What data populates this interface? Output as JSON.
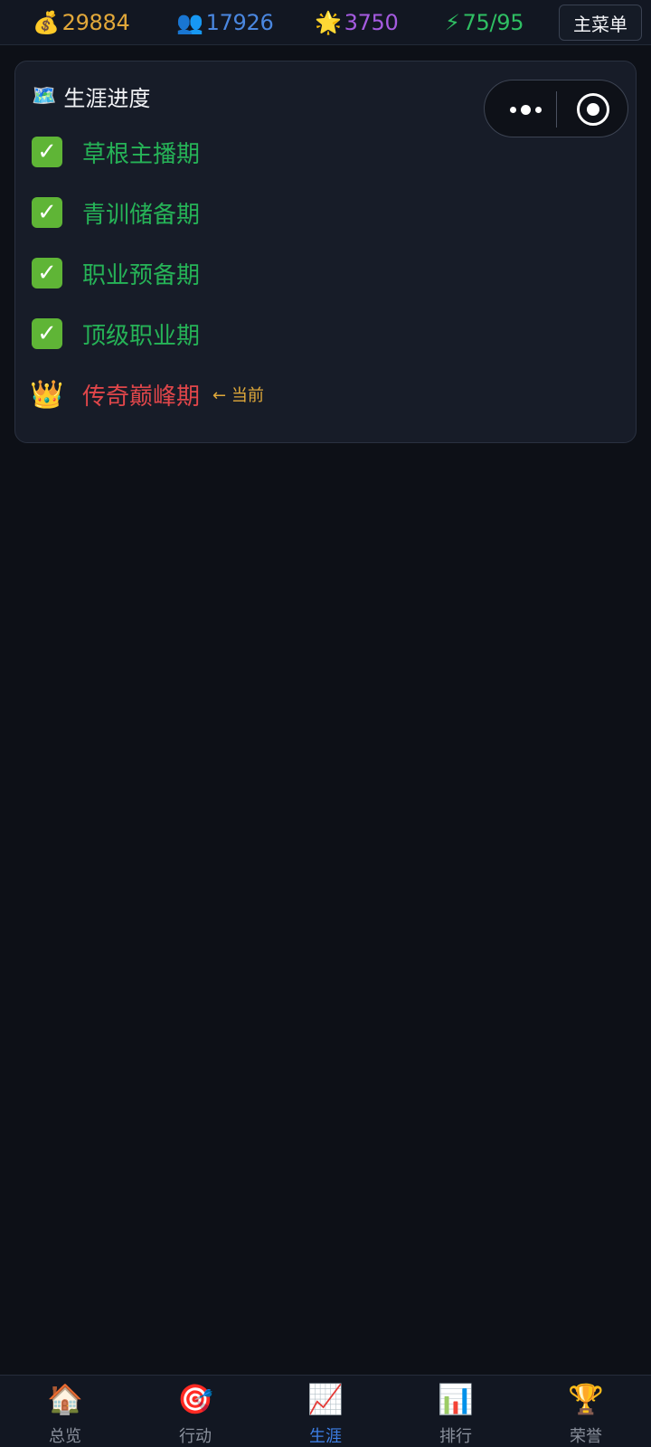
{
  "topbar": {
    "money": {
      "icon": "money-bag",
      "value": "29884"
    },
    "fans": {
      "icon": "people",
      "value": "17926"
    },
    "fame": {
      "icon": "sun",
      "value": "3750"
    },
    "energy": {
      "icon": "lightning",
      "value": "75/95"
    },
    "menu_label": "主菜单",
    "colors": {
      "money": "#e2a83a",
      "fans": "#4a87e0",
      "fame": "#a55be0",
      "energy": "#2fbf63"
    }
  },
  "career": {
    "title_icon": "map",
    "title": "生涯进度",
    "stages": [
      {
        "name": "草根主播期",
        "status": "done"
      },
      {
        "name": "青训储备期",
        "status": "done"
      },
      {
        "name": "职业预备期",
        "status": "done"
      },
      {
        "name": "顶级职业期",
        "status": "done"
      },
      {
        "name": "传奇巅峰期",
        "status": "current",
        "marker": "← 当前"
      }
    ],
    "colors": {
      "done": "#26b357",
      "current": "#e0464a",
      "marker": "#e0a93a"
    }
  },
  "bottom_nav": {
    "items": [
      {
        "label": "总览",
        "icon": "house"
      },
      {
        "label": "行动",
        "icon": "dart-target"
      },
      {
        "label": "生涯",
        "icon": "chart-increasing",
        "active": true
      },
      {
        "label": "排行",
        "icon": "bar-chart"
      },
      {
        "label": "荣誉",
        "icon": "trophy"
      }
    ],
    "colors": {
      "active": "#3d7fe6",
      "inactive": "#8a909c"
    }
  }
}
